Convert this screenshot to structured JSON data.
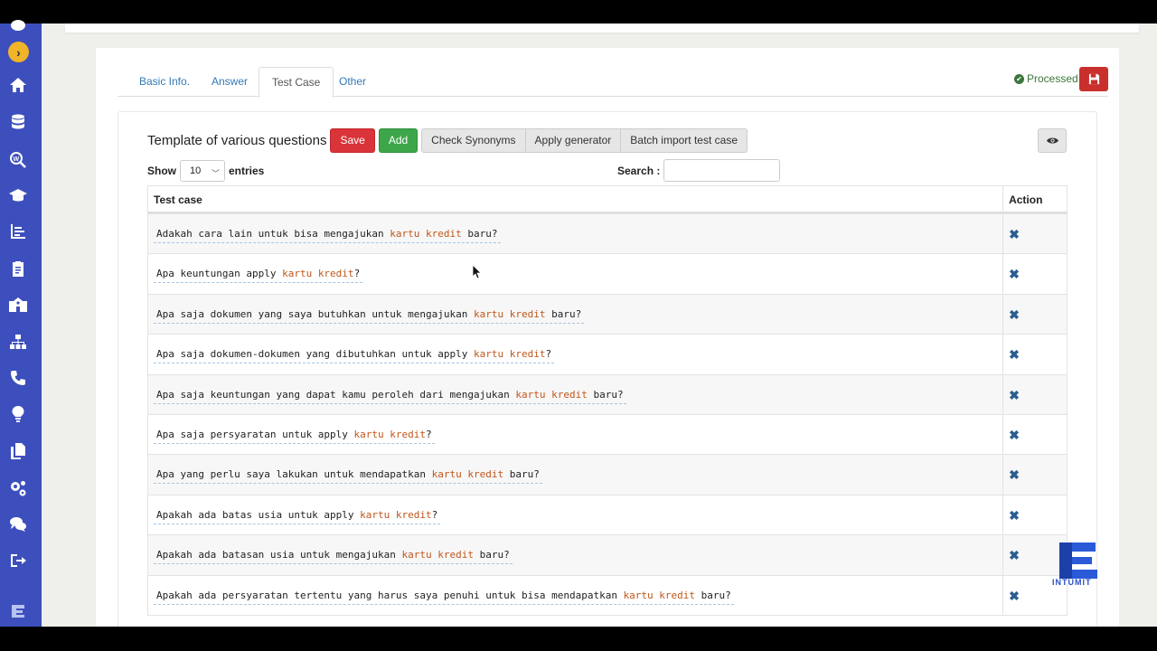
{
  "tabs": [
    {
      "label": "Basic Info."
    },
    {
      "label": "Answer"
    },
    {
      "label": "Test Case"
    },
    {
      "label": "Other"
    }
  ],
  "status": {
    "label": "Processed",
    "color": "#3c763d"
  },
  "toolbar": {
    "title": "Template of various questions",
    "save_label": "Save",
    "add_label": "Add",
    "check_synonyms_label": "Check Synonyms",
    "apply_generator_label": "Apply generator",
    "batch_import_label": "Batch import test case"
  },
  "length": {
    "show_label": "Show",
    "selected": "10",
    "entries_label": "entries"
  },
  "search": {
    "label": "Search :",
    "value": ""
  },
  "table": {
    "headers": {
      "case": "Test case",
      "action": "Action"
    },
    "rows": [
      {
        "pre": "Adakah cara lain untuk bisa mengajukan ",
        "kw": "kartu kredit",
        "post": " baru?"
      },
      {
        "pre": "Apa keuntungan apply ",
        "kw": "kartu kredit",
        "post": "?"
      },
      {
        "pre": "Apa saja dokumen yang saya butuhkan untuk mengajukan ",
        "kw": "kartu kredit",
        "post": " baru?"
      },
      {
        "pre": "Apa saja dokumen-dokumen yang dibutuhkan untuk apply ",
        "kw": "kartu kredit",
        "post": "?"
      },
      {
        "pre": "Apa saja keuntungan yang dapat kamu peroleh dari mengajukan ",
        "kw": "kartu kredit",
        "post": " baru?"
      },
      {
        "pre": "Apa saja persyaratan untuk apply ",
        "kw": "kartu kredit",
        "post": "?"
      },
      {
        "pre": "Apa yang perlu saya lakukan untuk mendapatkan ",
        "kw": "kartu kredit",
        "post": " baru?"
      },
      {
        "pre": "Apakah ada batas usia untuk apply ",
        "kw": "kartu kredit",
        "post": "?"
      },
      {
        "pre": "Apakah ada batasan usia untuk mengajukan ",
        "kw": "kartu kredit",
        "post": " baru?"
      },
      {
        "pre": "Apakah ada persyaratan tertentu yang harus saya penuhi untuk bisa mendapatkan ",
        "kw": "kartu kredit",
        "post": " baru?"
      }
    ]
  },
  "brand": {
    "name": "INTUMIT"
  },
  "colors": {
    "sidebar": "#3d4fbd",
    "save": "#d9343a",
    "add": "#3ea64a",
    "keyword": "#c0561a"
  }
}
